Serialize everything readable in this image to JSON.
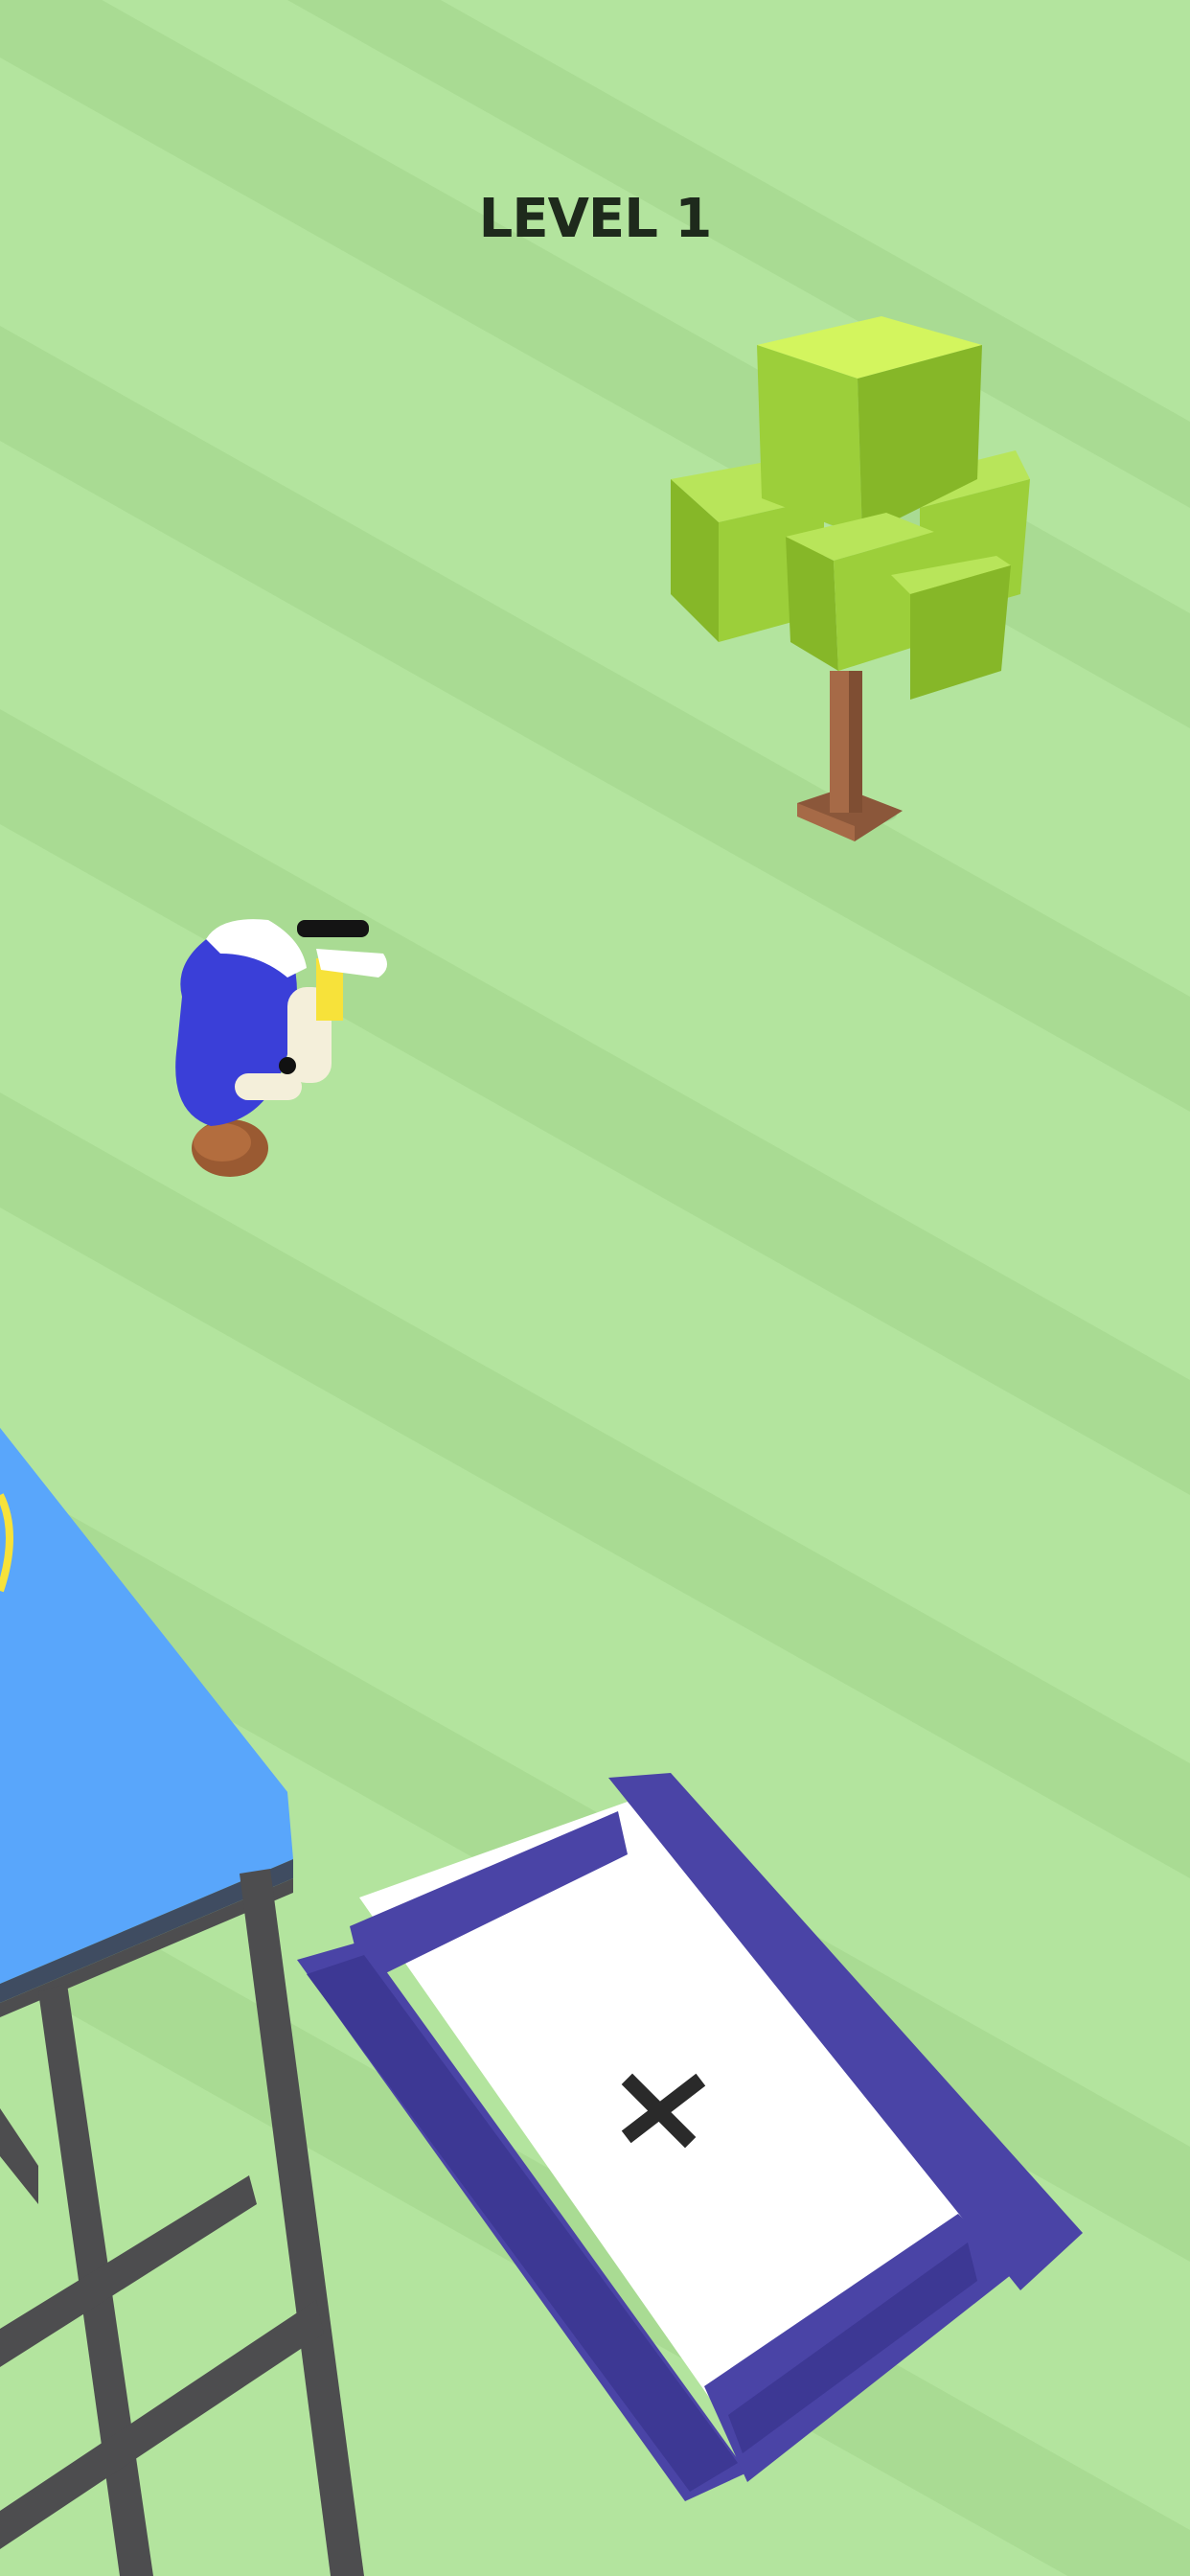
{
  "hud": {
    "level_label": "LEVEL 1"
  },
  "scene": {
    "objects": [
      "tree",
      "player-character",
      "jump-tower",
      "trampoline"
    ],
    "trampoline_mark": "✕"
  },
  "colors": {
    "grass_light": "#b3e49e",
    "grass_dark": "#a7da91",
    "tower_top": "#59a6fb",
    "tower_frame": "#4d4d4f",
    "trampoline_frame": "#4a44a6",
    "trampoline_mat": "#ffffff",
    "tree_leaves": "#9ccf3a",
    "tree_trunk": "#a66a47",
    "player_shirt": "#3a3fd8"
  }
}
